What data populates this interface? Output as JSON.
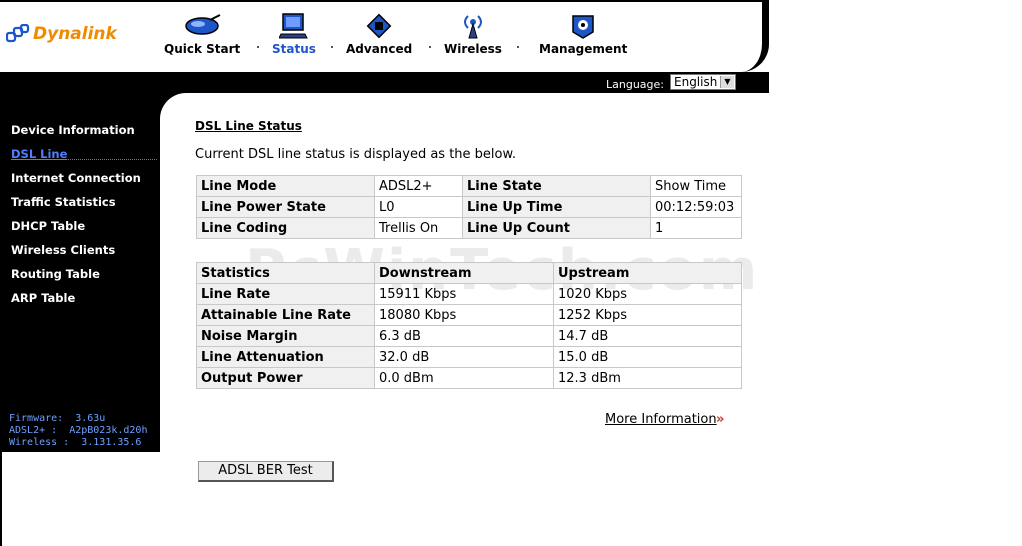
{
  "brand": {
    "name": "Dynalink"
  },
  "nav": {
    "quick_start": "Quick Start",
    "status": "Status",
    "advanced": "Advanced",
    "wireless": "Wireless",
    "management": "Management"
  },
  "language": {
    "label": "Language:",
    "selected": "English"
  },
  "sidebar": {
    "items": [
      {
        "label": "Device Information"
      },
      {
        "label": "DSL Line"
      },
      {
        "label": "Internet Connection"
      },
      {
        "label": "Traffic Statistics"
      },
      {
        "label": "DHCP Table"
      },
      {
        "label": "Wireless Clients"
      },
      {
        "label": "Routing Table"
      },
      {
        "label": "ARP Table"
      }
    ],
    "active": "DSL Line",
    "firmware": "Firmware:  3.63u",
    "adsl": "ADSL2+ :  A2pB023k.d20h",
    "wireless": "Wireless :  3.131.35.6"
  },
  "main": {
    "title": "DSL Line Status",
    "description": "Current DSL line status is displayed as the below.",
    "line_table": [
      [
        "Line Mode",
        "ADSL2+",
        "Line State",
        "Show Time"
      ],
      [
        "Line Power State",
        "L0",
        "Line Up Time",
        "00:12:59:03"
      ],
      [
        "Line Coding",
        "Trellis On",
        "Line Up Count",
        "1"
      ]
    ],
    "stats_table": {
      "headers": [
        "Statistics",
        "Downstream",
        "Upstream"
      ],
      "rows": [
        [
          "Line Rate",
          "15911 Kbps",
          "1020 Kbps"
        ],
        [
          "Attainable Line Rate",
          "18080 Kbps",
          "1252 Kbps"
        ],
        [
          "Noise Margin",
          "6.3 dB",
          "14.7 dB"
        ],
        [
          "Line Attenuation",
          "32.0 dB",
          "15.0 dB"
        ],
        [
          "Output Power",
          "0.0 dBm",
          "12.3 dBm"
        ]
      ]
    },
    "more_info": "More Information",
    "ber_button": "ADSL BER Test",
    "watermark": "PcWinTech.com"
  },
  "colors": {
    "accent": "#1e56c8",
    "brand": "#f08a00",
    "sidebar_bg": "#000000",
    "firmware_text": "#6fa0ff"
  }
}
